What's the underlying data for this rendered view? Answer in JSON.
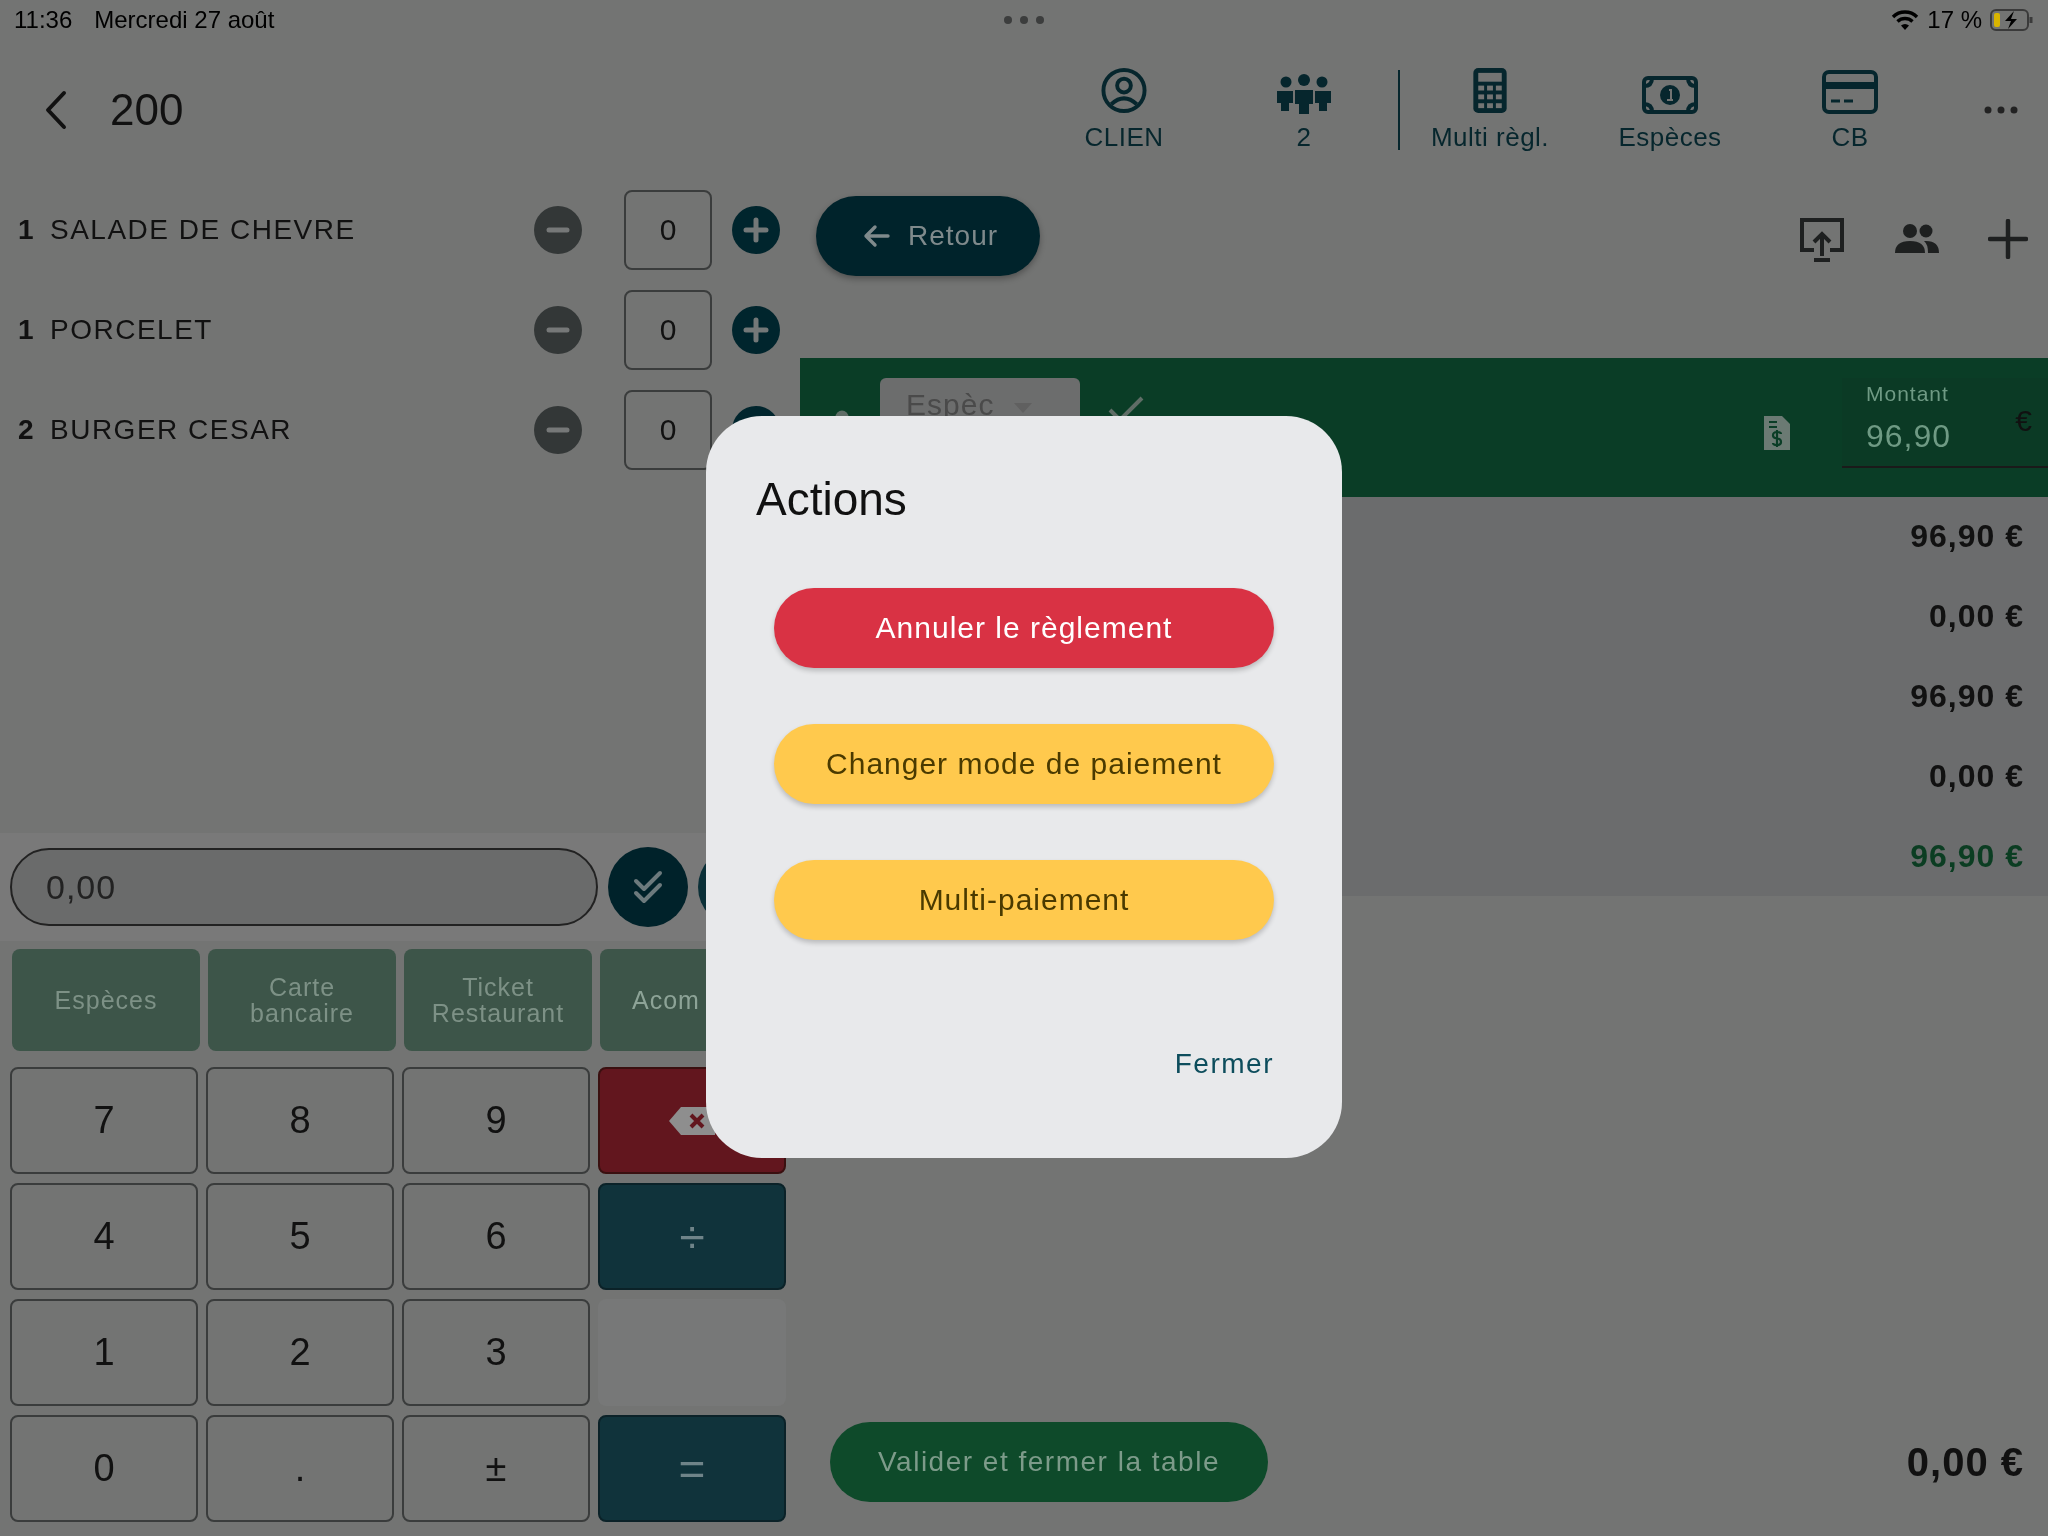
{
  "status_bar": {
    "time": "11:36",
    "date": "Mercredi 27 août",
    "battery": "17 %"
  },
  "header": {
    "title": "200",
    "actions": [
      {
        "kind": "client",
        "label": "CLIEN"
      },
      {
        "kind": "guests",
        "label": "2"
      },
      {
        "kind": "calculator",
        "label": "Multi règl."
      },
      {
        "kind": "cash",
        "label": "Espèces"
      },
      {
        "kind": "card",
        "label": "CB"
      }
    ]
  },
  "order_items": [
    {
      "quantity": "1",
      "name": "SALADE DE CHEVRE",
      "count": "0"
    },
    {
      "quantity": "1",
      "name": "PORCELET",
      "count": "0"
    },
    {
      "quantity": "2",
      "name": "BURGER CESAR",
      "count": "0"
    }
  ],
  "amount_field": {
    "value": "0,00"
  },
  "payment_methods": [
    "Espèces",
    "Carte bancaire",
    "Ticket Restaurant",
    "Acom"
  ],
  "keypad": [
    {
      "kind": "digit",
      "label": "7"
    },
    {
      "kind": "digit",
      "label": "8"
    },
    {
      "kind": "digit",
      "label": "9"
    },
    {
      "kind": "backspace"
    },
    {
      "kind": "digit",
      "label": "4"
    },
    {
      "kind": "digit",
      "label": "5"
    },
    {
      "kind": "digit",
      "label": "6"
    },
    {
      "kind": "operator",
      "label": "÷"
    },
    {
      "kind": "digit",
      "label": "1"
    },
    {
      "kind": "digit",
      "label": "2"
    },
    {
      "kind": "digit",
      "label": "3"
    },
    {
      "kind": "blank"
    },
    {
      "kind": "digit",
      "label": "0"
    },
    {
      "kind": "digit",
      "label": "."
    },
    {
      "kind": "digit",
      "label": "±"
    },
    {
      "kind": "operator",
      "label": "="
    }
  ],
  "back_button": "Retour",
  "payment_line": {
    "method": "Espèc",
    "amount_label": "Montant",
    "amount": "96,90",
    "currency": "€"
  },
  "totals": [
    {
      "value": "96,90 €",
      "highlight": false
    },
    {
      "value": "0,00 €",
      "highlight": false
    },
    {
      "value": "96,90 €",
      "highlight": false
    },
    {
      "value": "0,00 €",
      "highlight": false
    },
    {
      "value": "96,90 €",
      "highlight": true
    }
  ],
  "validate_button": "Valider et fermer la table",
  "remaining": "0,00 €",
  "dialog": {
    "title": "Actions",
    "actions": [
      {
        "label": "Annuler le règlement",
        "kind": "danger"
      },
      {
        "label": "Changer mode de paiement",
        "kind": "warning"
      },
      {
        "label": "Multi-paiement",
        "kind": "warning"
      }
    ],
    "close": "Fermer"
  }
}
